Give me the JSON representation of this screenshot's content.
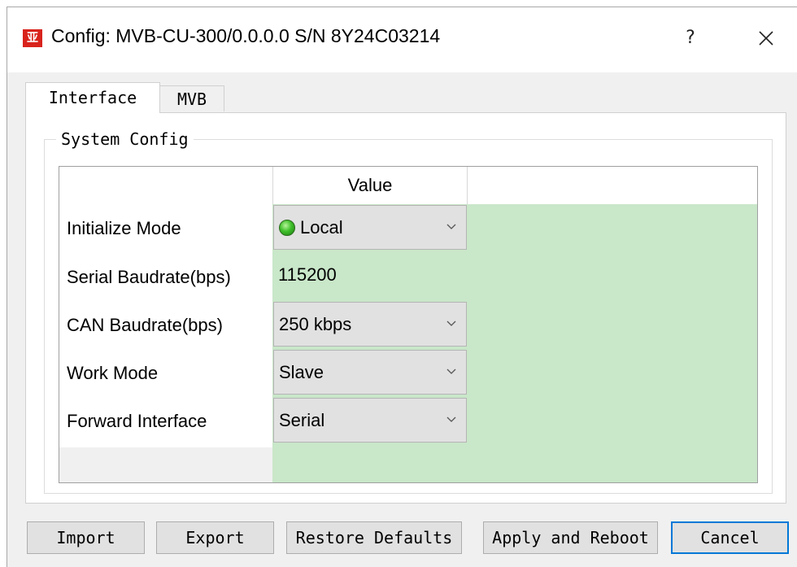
{
  "window": {
    "app_icon_text": "亚",
    "title": "Config: MVB-CU-300/0.0.0.0  S/N 8Y24C03214",
    "help_label": "?"
  },
  "tabs": [
    {
      "label": "Interface",
      "active": true
    },
    {
      "label": "MVB",
      "active": false
    }
  ],
  "group": {
    "title": "System Config"
  },
  "grid": {
    "value_header": "Value",
    "rows": [
      {
        "label": "Initialize Mode",
        "value": "Local",
        "type": "combo",
        "status_icon": "green-led-icon"
      },
      {
        "label": "Serial Baudrate(bps)",
        "value": "115200",
        "type": "text"
      },
      {
        "label": "CAN Baudrate(bps)",
        "value": "250 kbps",
        "type": "combo"
      },
      {
        "label": "Work Mode",
        "value": "Slave",
        "type": "combo"
      },
      {
        "label": "Forward Interface",
        "value": "Serial",
        "type": "combo"
      }
    ]
  },
  "buttons": {
    "import": "Import",
    "export": "Export",
    "restore_defaults": "Restore Defaults",
    "apply_reboot": "Apply and Reboot",
    "cancel": "Cancel"
  },
  "colors": {
    "value_area": "#c9e7c9",
    "accent": "#0078d7",
    "app_icon": "#d8231c"
  }
}
